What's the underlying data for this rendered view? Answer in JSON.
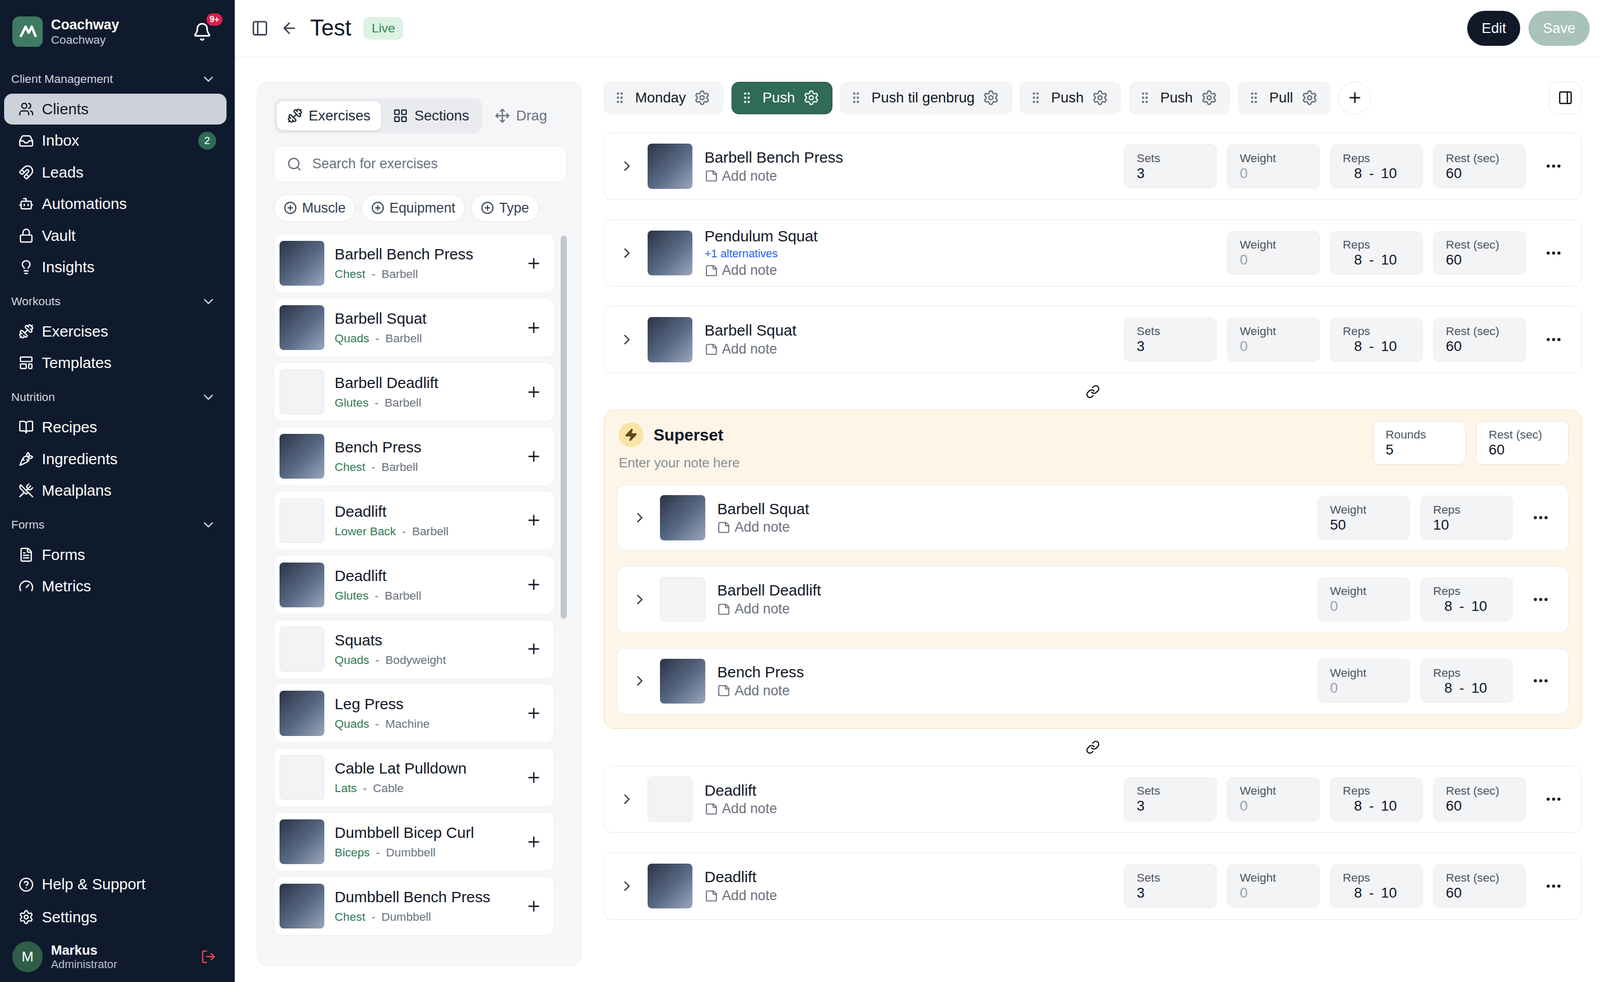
{
  "sidebar": {
    "brand": {
      "name": "Coachway",
      "sub": "Coachway"
    },
    "notifications": {
      "badge": "9+"
    },
    "sections": [
      {
        "title": "Client Management",
        "expanded": true,
        "items": [
          {
            "label": "Clients",
            "selected": true
          },
          {
            "label": "Inbox",
            "selected": false,
            "badge": "2"
          },
          {
            "label": "Leads",
            "selected": false
          },
          {
            "label": "Automations",
            "selected": false
          },
          {
            "label": "Vault",
            "selected": false
          },
          {
            "label": "Insights",
            "selected": false
          }
        ]
      },
      {
        "title": "Workouts",
        "expanded": true,
        "items": [
          {
            "label": "Exercises",
            "selected": false
          },
          {
            "label": "Templates",
            "selected": false
          }
        ]
      },
      {
        "title": "Nutrition",
        "expanded": true,
        "items": [
          {
            "label": "Recipes",
            "selected": false
          },
          {
            "label": "Ingredients",
            "selected": false
          },
          {
            "label": "Mealplans",
            "selected": false
          }
        ]
      },
      {
        "title": "Forms",
        "expanded": true,
        "items": [
          {
            "label": "Forms",
            "selected": false
          },
          {
            "label": "Metrics",
            "selected": false
          }
        ]
      }
    ],
    "footer": [
      {
        "label": "Help & Support"
      },
      {
        "label": "Settings"
      }
    ],
    "user": {
      "initial": "M",
      "name": "Markus",
      "role": "Administrator"
    }
  },
  "header": {
    "title": "Test",
    "status": "Live",
    "buttons": [
      {
        "label": "Edit",
        "disabled": false
      },
      {
        "label": "Save",
        "disabled": true
      }
    ]
  },
  "library": {
    "tabs": [
      {
        "label": "Exercises",
        "selected": true
      },
      {
        "label": "Sections",
        "selected": false
      },
      {
        "label": "Drag",
        "selected": false
      }
    ],
    "search": {
      "placeholder": "Search for exercises"
    },
    "filters": [
      "Muscle",
      "Equipment",
      "Type"
    ],
    "separator": "-",
    "items": [
      {
        "name": "Barbell Bench Press",
        "muscle": "Chest",
        "equipment": "Barbell",
        "thumb": "photo"
      },
      {
        "name": "Barbell Squat",
        "muscle": "Quads",
        "equipment": "Barbell",
        "thumb": "photo"
      },
      {
        "name": "Barbell Deadlift",
        "muscle": "Glutes",
        "equipment": "Barbell",
        "thumb": "drawing"
      },
      {
        "name": "Bench Press",
        "muscle": "Chest",
        "equipment": "Barbell",
        "thumb": "photo"
      },
      {
        "name": "Deadlift",
        "muscle": "Lower Back",
        "equipment": "Barbell",
        "thumb": "drawing"
      },
      {
        "name": "Deadlift",
        "muscle": "Glutes",
        "equipment": "Barbell",
        "thumb": "photo"
      },
      {
        "name": "Squats",
        "muscle": "Quads",
        "equipment": "Bodyweight",
        "thumb": "drawing"
      },
      {
        "name": "Leg Press",
        "muscle": "Quads",
        "equipment": "Machine",
        "thumb": "photo"
      },
      {
        "name": "Cable Lat Pulldown",
        "muscle": "Lats",
        "equipment": "Cable",
        "thumb": "drawing"
      },
      {
        "name": "Dumbbell Bicep Curl",
        "muscle": "Biceps",
        "equipment": "Dumbbell",
        "thumb": "photo"
      },
      {
        "name": "Dumbbell Bench Press",
        "muscle": "Chest",
        "equipment": "Dumbbell",
        "thumb": "photo"
      }
    ]
  },
  "days": [
    {
      "label": "Monday",
      "selected": false
    },
    {
      "label": "Push",
      "selected": true
    },
    {
      "label": "Push til genbrug",
      "selected": false
    },
    {
      "label": "Push",
      "selected": false
    },
    {
      "label": "Push",
      "selected": false
    },
    {
      "label": "Pull",
      "selected": false
    }
  ],
  "range_separator": "-",
  "workout": [
    {
      "kind": "exercise",
      "name": "Barbell Bench Press",
      "thumb": "photo",
      "note": "Add note",
      "fields": [
        {
          "label": "Sets",
          "value": "3",
          "empty": false
        },
        {
          "label": "Weight",
          "value": "0",
          "empty": true
        },
        {
          "label": "Reps",
          "value": "8",
          "to": "10",
          "empty": false
        },
        {
          "label": "Rest (sec)",
          "value": "60",
          "empty": false
        }
      ]
    },
    {
      "kind": "exercise",
      "name": "Pendulum Squat",
      "thumb": "photo",
      "alternatives": "+1 alternatives",
      "note": "Add note",
      "fields": [
        {
          "label": "Weight",
          "value": "0",
          "empty": true
        },
        {
          "label": "Reps",
          "value": "8",
          "to": "10",
          "empty": false
        },
        {
          "label": "Rest (sec)",
          "value": "60",
          "empty": false
        }
      ]
    },
    {
      "kind": "exercise",
      "name": "Barbell Squat",
      "thumb": "photo",
      "note": "Add note",
      "fields": [
        {
          "label": "Sets",
          "value": "3",
          "empty": false
        },
        {
          "label": "Weight",
          "value": "0",
          "empty": true
        },
        {
          "label": "Reps",
          "value": "8",
          "to": "10",
          "empty": false
        },
        {
          "label": "Rest (sec)",
          "value": "60",
          "empty": false
        }
      ]
    },
    {
      "kind": "link"
    },
    {
      "kind": "superset",
      "title": "Superset",
      "note_placeholder": "Enter your note here",
      "fields": [
        {
          "label": "Rounds",
          "value": "5",
          "empty": false
        },
        {
          "label": "Rest (sec)",
          "value": "60",
          "empty": false
        }
      ],
      "items": [
        {
          "name": "Barbell Squat",
          "thumb": "photo",
          "note": "Add note",
          "fields": [
            {
              "label": "Weight",
              "value": "50",
              "empty": false
            },
            {
              "label": "Reps",
              "value": "10",
              "empty": false
            }
          ]
        },
        {
          "name": "Barbell Deadlift",
          "thumb": "drawing",
          "note": "Add note",
          "fields": [
            {
              "label": "Weight",
              "value": "0",
              "empty": true
            },
            {
              "label": "Reps",
              "value": "8",
              "to": "10",
              "empty": false
            }
          ]
        },
        {
          "name": "Bench Press",
          "thumb": "photo",
          "note": "Add note",
          "fields": [
            {
              "label": "Weight",
              "value": "0",
              "empty": true
            },
            {
              "label": "Reps",
              "value": "8",
              "to": "10",
              "empty": false
            }
          ]
        }
      ]
    },
    {
      "kind": "link"
    },
    {
      "kind": "exercise",
      "name": "Deadlift",
      "thumb": "drawing",
      "note": "Add note",
      "fields": [
        {
          "label": "Sets",
          "value": "3",
          "empty": false
        },
        {
          "label": "Weight",
          "value": "0",
          "empty": true
        },
        {
          "label": "Reps",
          "value": "8",
          "to": "10",
          "empty": false
        },
        {
          "label": "Rest (sec)",
          "value": "60",
          "empty": false
        }
      ]
    },
    {
      "kind": "exercise",
      "name": "Deadlift",
      "thumb": "photo",
      "note": "Add note",
      "fields": [
        {
          "label": "Sets",
          "value": "3",
          "empty": false
        },
        {
          "label": "Weight",
          "value": "0",
          "empty": true
        },
        {
          "label": "Reps",
          "value": "8",
          "to": "10",
          "empty": false
        },
        {
          "label": "Rest (sec)",
          "value": "60",
          "empty": false
        }
      ]
    }
  ]
}
